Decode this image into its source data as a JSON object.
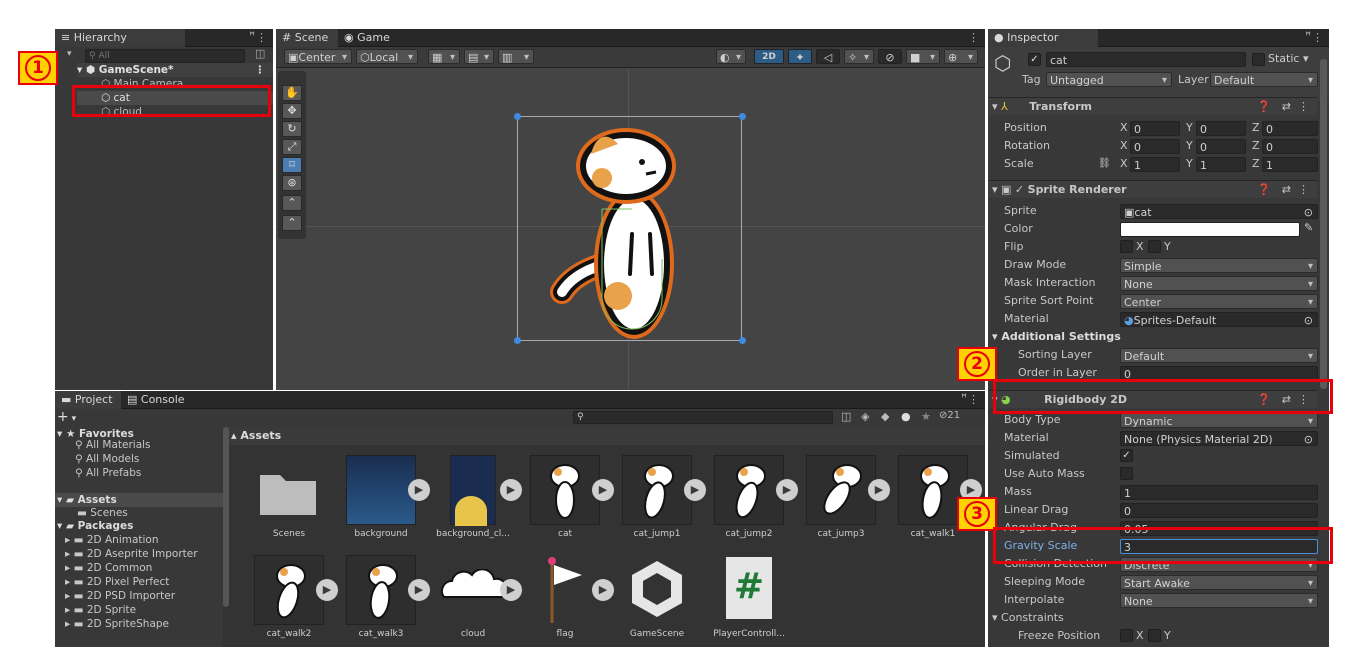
{
  "hierarchy": {
    "tab": "Hierarchy",
    "search_placeholder": "All",
    "items": [
      "GameScene*",
      "Main Camera",
      "cat",
      "cloud"
    ]
  },
  "scene": {
    "tab_scene": "Scene",
    "tab_game": "Game",
    "pivot": "Center",
    "space": "Local",
    "mode_2d": "2D"
  },
  "project": {
    "tab_project": "Project",
    "tab_console": "Console",
    "add": "+",
    "hidden_count": "21",
    "breadcrumb": "Assets",
    "favorites": {
      "label": "Favorites",
      "items": [
        "All Materials",
        "All Models",
        "All Prefabs"
      ]
    },
    "assets_label": "Assets",
    "assets_children": [
      "Scenes"
    ],
    "packages_label": "Packages",
    "packages": [
      "2D Animation",
      "2D Aseprite Importer",
      "2D Common",
      "2D Pixel Perfect",
      "2D PSD Importer",
      "2D Sprite",
      "2D SpriteShape"
    ],
    "grid": [
      "Scenes",
      "background",
      "background_cl...",
      "cat",
      "cat_jump1",
      "cat_jump2",
      "cat_jump3",
      "cat_walk1",
      "cat_walk2",
      "cat_walk3",
      "cloud",
      "flag",
      "GameScene",
      "PlayerControll..."
    ]
  },
  "inspector": {
    "tab": "Inspector",
    "name": "cat",
    "static": "Static",
    "tag_label": "Tag",
    "tag": "Untagged",
    "layer_label": "Layer",
    "layer": "Default",
    "transform": {
      "title": "Transform",
      "position": "Position",
      "rotation": "Rotation",
      "scale": "Scale",
      "pos": [
        "0",
        "0",
        "0"
      ],
      "rot": [
        "0",
        "0",
        "0"
      ],
      "scl": [
        "1",
        "1",
        "1"
      ],
      "x": "X",
      "y": "Y",
      "z": "Z"
    },
    "sprite_renderer": {
      "title": "Sprite Renderer",
      "sprite_label": "Sprite",
      "sprite": "cat",
      "color_label": "Color",
      "flip_label": "Flip",
      "flip_x": "X",
      "flip_y": "Y",
      "draw_mode_label": "Draw Mode",
      "draw_mode": "Simple",
      "mask_label": "Mask Interaction",
      "mask": "None",
      "sort_point_label": "Sprite Sort Point",
      "sort_point": "Center",
      "material_label": "Material",
      "material": "Sprites-Default",
      "additional": "Additional Settings",
      "sorting_layer_label": "Sorting Layer",
      "sorting_layer": "Default",
      "order_label": "Order in Layer",
      "order": "0"
    },
    "rigidbody": {
      "title": "Rigidbody 2D",
      "body_type_label": "Body Type",
      "body_type": "Dynamic",
      "material_label": "Material",
      "material": "None (Physics Material 2D)",
      "simulated_label": "Simulated",
      "auto_mass_label": "Use Auto Mass",
      "mass_label": "Mass",
      "mass": "1",
      "linear_label": "Linear Drag",
      "linear": "0",
      "angular_label": "Angular Drag",
      "angular": "0.05",
      "gravity_label": "Gravity Scale",
      "gravity": "3",
      "collision_label": "Collision Detection",
      "collision": "Discrete",
      "sleeping_label": "Sleeping Mode",
      "sleeping": "Start Awake",
      "interpolate_label": "Interpolate",
      "interpolate": "None",
      "constraints": "Constraints",
      "freeze_label": "Freeze Position",
      "freeze_x": "X",
      "freeze_y": "Y"
    }
  },
  "annotations": [
    "1",
    "2",
    "3"
  ],
  "colors": {
    "highlight": "#e8000b",
    "badge": "#ffd200",
    "selection": "#2c5d87"
  }
}
